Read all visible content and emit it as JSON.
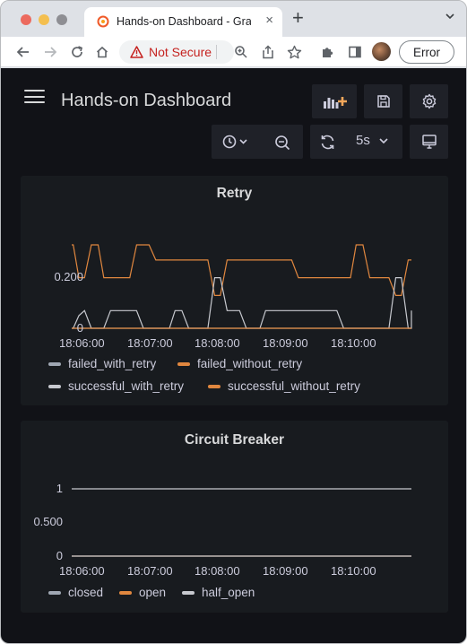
{
  "browser": {
    "tab": {
      "title": "Hands-on Dashboard - Grafana",
      "close_glyph": "×"
    },
    "new_tab_glyph": "+",
    "security_label": "Not Secure",
    "profile_status": "Error",
    "icons": [
      "chevron-down-icon",
      "back-arrow-icon",
      "forward-arrow-icon",
      "reload-icon",
      "home-icon",
      "warning-icon",
      "zoom-icon",
      "share-icon",
      "bookmark-star-icon",
      "extensions-puzzle-icon",
      "sidebar-icon"
    ]
  },
  "dashboard": {
    "title": "Hands-on Dashboard",
    "refresh_interval": "5s",
    "icons": [
      "menu-icon",
      "add-panel-icon",
      "save-icon",
      "settings-gear-icon",
      "clock-icon",
      "zoom-out-icon",
      "refresh-icon",
      "tv-mode-icon"
    ]
  },
  "colors": {
    "bg": "#111217",
    "panel": "#181b1f",
    "orange": "#e0873f",
    "white_series": "#c7c9cf",
    "text": "#ccccdc"
  },
  "chart_data": [
    {
      "type": "line",
      "title": "Retry",
      "x_ticks": [
        "18:06:00",
        "18:07:00",
        "18:08:00",
        "18:09:00",
        "18:10:00"
      ],
      "y_ticks": [
        "0.200",
        "0"
      ],
      "ylim": [
        0,
        0.33
      ],
      "grid": false,
      "legend_placement": "bottom",
      "x": [
        "18:05:49",
        "18:05:55",
        "18:06:00",
        "18:06:05",
        "18:06:11",
        "18:06:17",
        "18:06:22",
        "18:06:28",
        "18:06:34",
        "18:06:40",
        "18:06:45",
        "18:06:51",
        "18:06:57",
        "18:07:02",
        "18:07:08",
        "18:07:14",
        "18:07:20",
        "18:07:25",
        "18:07:31",
        "18:07:37",
        "18:07:42",
        "18:07:48",
        "18:07:54",
        "18:08:00",
        "18:08:05",
        "18:08:11",
        "18:08:17",
        "18:08:22",
        "18:08:28",
        "18:08:34",
        "18:08:40",
        "18:08:45",
        "18:08:51",
        "18:08:57",
        "18:09:02",
        "18:09:08",
        "18:09:14",
        "18:09:20",
        "18:09:25",
        "18:09:31",
        "18:09:37",
        "18:09:42",
        "18:09:48",
        "18:09:54",
        "18:10:00",
        "18:10:05",
        "18:10:11",
        "18:10:17",
        "18:10:22",
        "18:10:28",
        "18:10:34",
        "18:10:40",
        "18:10:45",
        "18:10:51",
        "18:10:57",
        "18:11:02",
        "18:11:08",
        "18:11:14"
      ],
      "series": [
        {
          "name": "failed_with_retry",
          "color": "#9fa7b3",
          "values": [
            0,
            0,
            0,
            0,
            0,
            0,
            0,
            0,
            0,
            0,
            0,
            0,
            0,
            0,
            0,
            0,
            0,
            0,
            0,
            0,
            0,
            0,
            0,
            0,
            0,
            0,
            0,
            0,
            0,
            0,
            0,
            0,
            0,
            0,
            0,
            0,
            0,
            0,
            0,
            0,
            0,
            0,
            0,
            0,
            0,
            0,
            0,
            0,
            0,
            0,
            0,
            0,
            0,
            0,
            0,
            0,
            0,
            0
          ]
        },
        {
          "name": "failed_without_retry",
          "color": "#e0873f",
          "values": [
            0.33,
            0.33,
            0.2,
            0.2,
            0.33,
            0.33,
            0.2,
            0.2,
            0.2,
            0.2,
            0.2,
            0.33,
            0.33,
            0.33,
            0.27,
            0.27,
            0.27,
            0.27,
            0.27,
            0.27,
            0.27,
            0.27,
            0.27,
            0.13,
            0.13,
            0.27,
            0.27,
            0.27,
            0.27,
            0.27,
            0.27,
            0.27,
            0.27,
            0.27,
            0.27,
            0.27,
            0.2,
            0.2,
            0.2,
            0.2,
            0.2,
            0.2,
            0.2,
            0.2,
            0.2,
            0.33,
            0.33,
            0.2,
            0.2,
            0.2,
            0.2,
            0.13,
            0.13,
            0.27,
            0.27,
            0.27,
            0.27,
            0.27
          ]
        },
        {
          "name": "successful_with_retry",
          "color": "#c7c9cf",
          "values": [
            0,
            0,
            0.05,
            0.07,
            0,
            0,
            0,
            0.07,
            0.07,
            0.07,
            0.07,
            0.07,
            0,
            0,
            0,
            0,
            0,
            0.07,
            0.07,
            0,
            0,
            0,
            0,
            0.2,
            0.2,
            0.07,
            0.07,
            0.07,
            0,
            0,
            0,
            0.07,
            0.07,
            0.07,
            0.07,
            0.07,
            0.07,
            0.07,
            0.07,
            0.07,
            0.07,
            0.07,
            0.07,
            0,
            0,
            0,
            0,
            0,
            0,
            0,
            0,
            0.2,
            0.2,
            0,
            0,
            0.07,
            0.07,
            0.07
          ]
        },
        {
          "name": "successful_without_retry",
          "color": "#e0873f",
          "values": [
            0,
            0,
            0,
            0,
            0,
            0,
            0,
            0,
            0,
            0,
            0,
            0,
            0,
            0,
            0,
            0,
            0,
            0,
            0,
            0,
            0,
            0,
            0,
            0,
            0,
            0,
            0,
            0,
            0,
            0,
            0,
            0,
            0,
            0,
            0,
            0,
            0,
            0,
            0,
            0,
            0,
            0,
            0,
            0,
            0,
            0,
            0,
            0,
            0,
            0,
            0,
            0,
            0,
            0,
            0,
            0,
            0,
            0
          ]
        }
      ]
    },
    {
      "type": "line",
      "title": "Circuit Breaker",
      "x_ticks": [
        "18:06:00",
        "18:07:00",
        "18:08:00",
        "18:09:00",
        "18:10:00"
      ],
      "y_ticks": [
        "1",
        "0.500",
        "0"
      ],
      "ylim": [
        0,
        1
      ],
      "grid": false,
      "legend_placement": "bottom",
      "x": [
        "18:05:47",
        "18:11:14"
      ],
      "series": [
        {
          "name": "closed",
          "color": "#c7c9cf",
          "values": [
            1,
            1
          ]
        },
        {
          "name": "open",
          "color": "#e0873f",
          "values": [
            0,
            0
          ]
        },
        {
          "name": "half_open",
          "color": "#c7c9cf",
          "values": [
            0,
            0
          ]
        }
      ]
    }
  ]
}
